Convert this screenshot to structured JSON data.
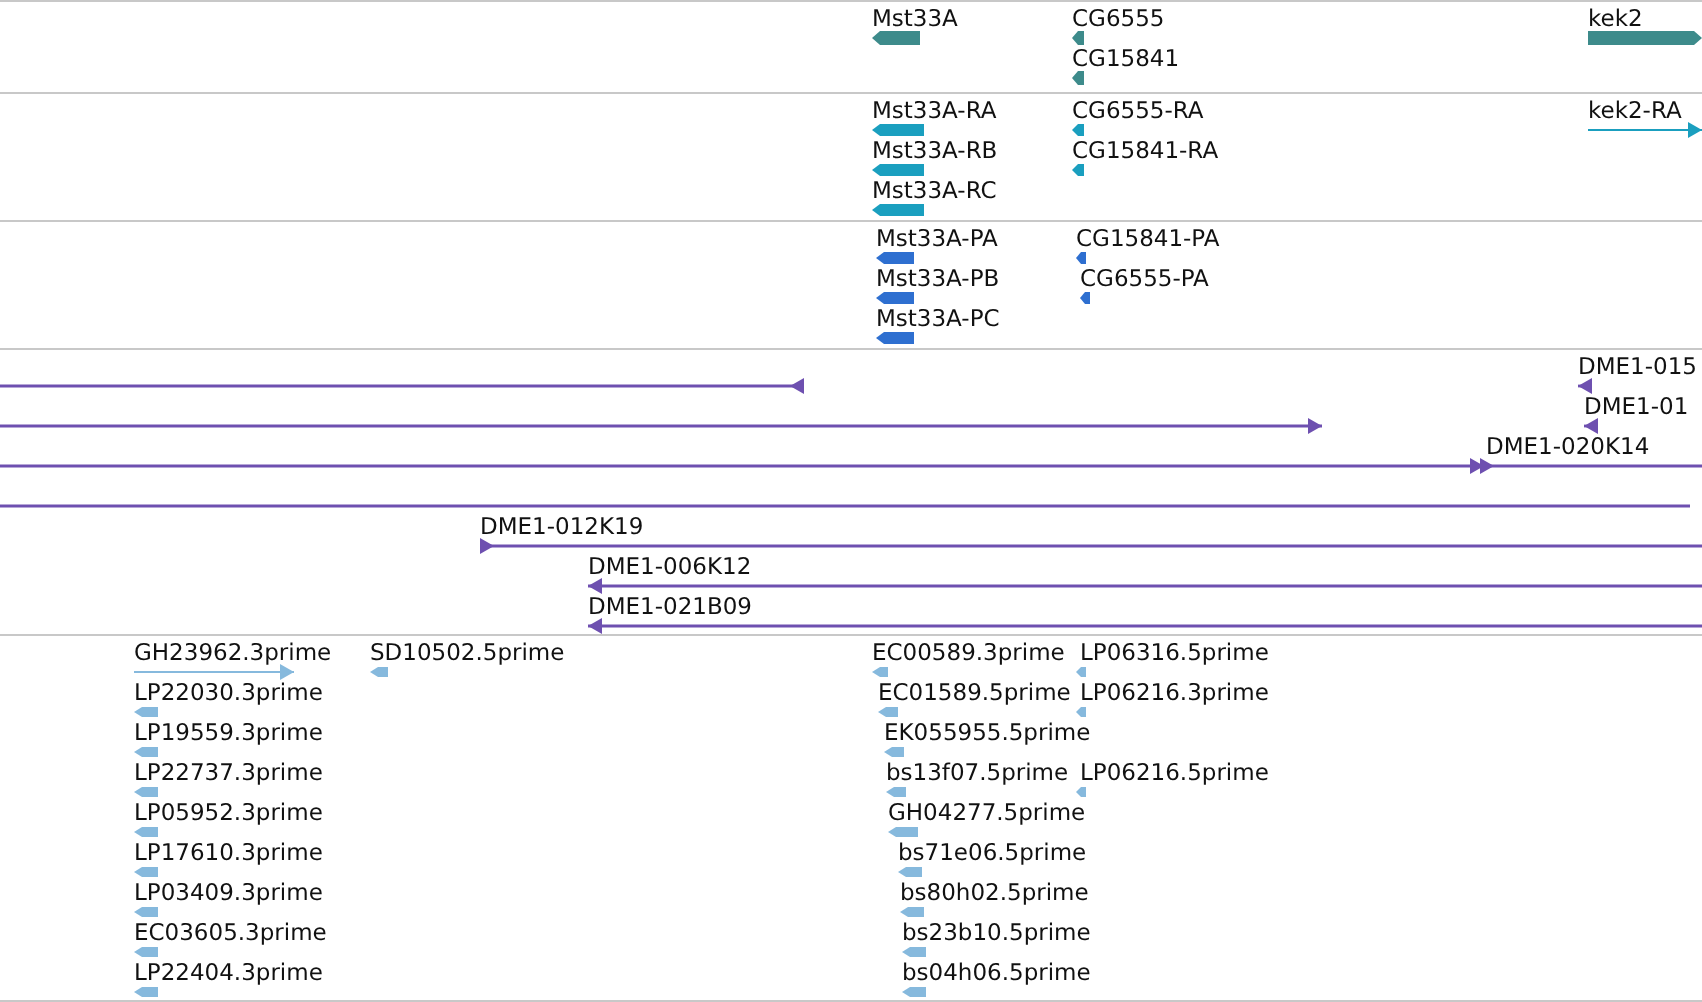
{
  "tracks": [
    {
      "kind": "gene",
      "features": [
        {
          "label": "Mst33A",
          "reverse": true
        },
        {
          "label": "CG6555",
          "reverse": true
        },
        {
          "label": "CG15841",
          "reverse": true
        },
        {
          "label": "kek2",
          "reverse": false
        }
      ]
    },
    {
      "kind": "transcript",
      "features": [
        {
          "label": "Mst33A-RA",
          "reverse": true
        },
        {
          "label": "Mst33A-RB",
          "reverse": true
        },
        {
          "label": "Mst33A-RC",
          "reverse": true
        },
        {
          "label": "CG6555-RA",
          "reverse": true
        },
        {
          "label": "CG15841-RA",
          "reverse": true
        },
        {
          "label": "kek2-RA",
          "reverse": false
        }
      ]
    },
    {
      "kind": "protein",
      "features": [
        {
          "label": "Mst33A-PA",
          "reverse": true
        },
        {
          "label": "Mst33A-PB",
          "reverse": true
        },
        {
          "label": "Mst33A-PC",
          "reverse": true
        },
        {
          "label": "CG15841-PA",
          "reverse": true
        },
        {
          "label": "CG6555-PA",
          "reverse": true
        }
      ]
    },
    {
      "kind": "clone",
      "features": [
        {
          "reverse": true
        },
        {
          "label": "DME1-015",
          "reverse": true
        },
        {
          "reverse": false
        },
        {
          "label": "DME1-01",
          "reverse": true
        },
        {
          "reverse": false
        },
        {
          "label": "DME1-020K14",
          "reverse": false
        },
        {
          "kind": "plain"
        },
        {
          "label": "DME1-012K19",
          "reverse": false
        },
        {
          "label": "DME1-006K12",
          "reverse": true
        },
        {
          "label": "DME1-021B09",
          "reverse": true
        }
      ]
    },
    {
      "kind": "est",
      "features": [
        {
          "label": "GH23962.3prime",
          "reverse": false
        },
        {
          "label": "LP22030.3prime",
          "reverse": true
        },
        {
          "label": "LP19559.3prime",
          "reverse": true
        },
        {
          "label": "LP22737.3prime",
          "reverse": true
        },
        {
          "label": "LP05952.3prime",
          "reverse": true
        },
        {
          "label": "LP17610.3prime",
          "reverse": true
        },
        {
          "label": "LP03409.3prime",
          "reverse": true
        },
        {
          "label": "EC03605.3prime",
          "reverse": true
        },
        {
          "label": "LP22404.3prime",
          "reverse": true
        },
        {
          "label": "SD10502.5prime",
          "reverse": true
        },
        {
          "label": "EC00589.3prime",
          "reverse": true
        },
        {
          "label": "EC01589.5prime",
          "reverse": true
        },
        {
          "label": "EK055955.5prime",
          "reverse": true
        },
        {
          "label": "bs13f07.5prime",
          "reverse": true
        },
        {
          "label": "GH04277.5prime",
          "reverse": true
        },
        {
          "label": "bs71e06.5prime",
          "reverse": true
        },
        {
          "label": "bs80h02.5prime",
          "reverse": true
        },
        {
          "label": "bs23b10.5prime",
          "reverse": true
        },
        {
          "label": "bs04h06.5prime",
          "reverse": true
        },
        {
          "label": "LP06316.5prime",
          "reverse": true
        },
        {
          "label": "LP06216.3prime",
          "reverse": true
        },
        {
          "label": "LP06216.5prime",
          "reverse": true
        }
      ]
    }
  ]
}
